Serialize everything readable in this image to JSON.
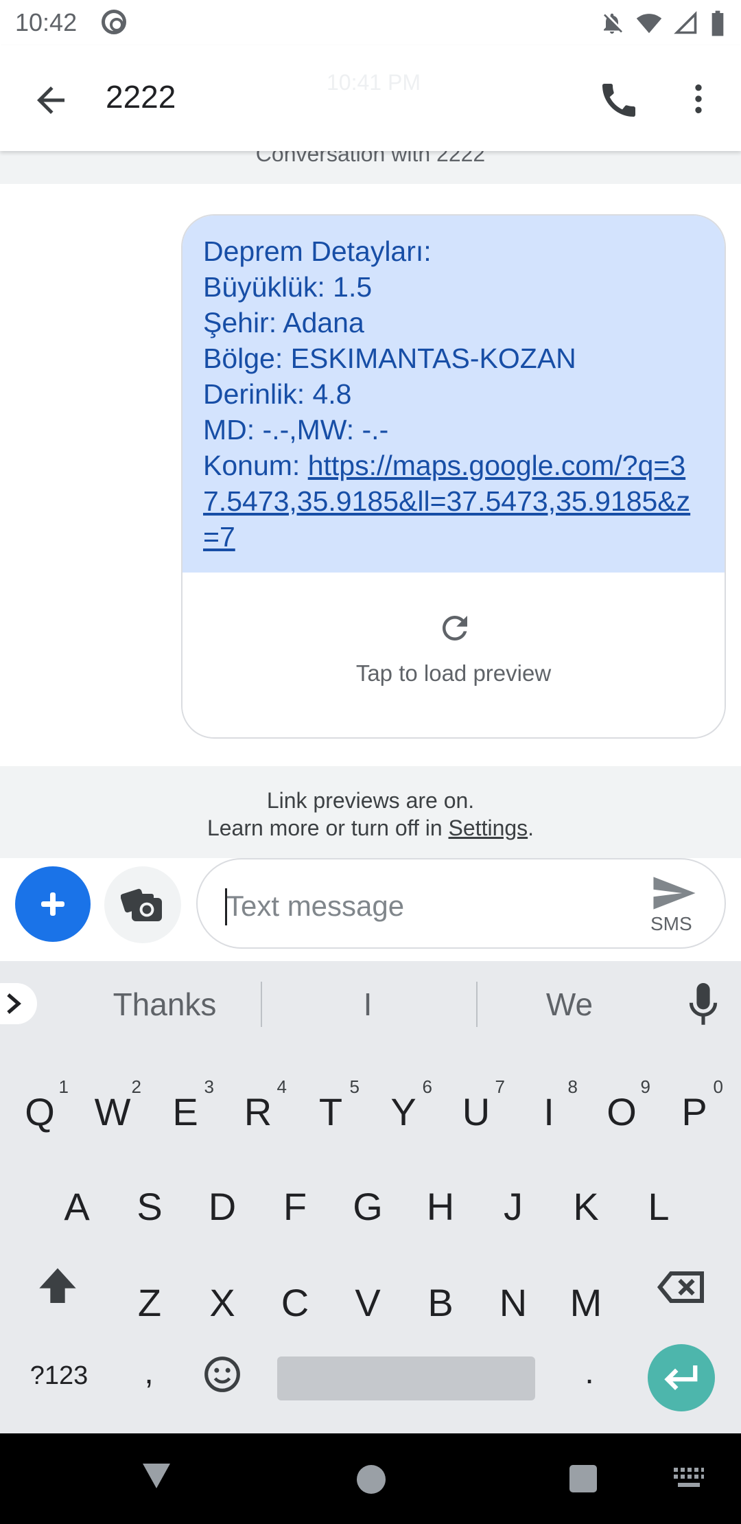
{
  "status_bar": {
    "time": "10:42"
  },
  "app_bar": {
    "title": "2222",
    "ghost_time": "10:41 PM"
  },
  "conversation_label": "Conversation with 2222",
  "message": {
    "lines": [
      "Deprem Detayları:",
      "Büyüklük: 1.5",
      "Şehir: Adana",
      "Bölge: ESKIMANTAS-KOZAN",
      "Derinlik: 4.8",
      "MD: -.-,MW: -.-"
    ],
    "location_label": "Konum: ",
    "location_link": "https://maps.google.com/?q=37.5473,35.9185&ll=37.5473,35.9185&z=7",
    "preview_label": "Tap to load preview"
  },
  "link_notice": {
    "line1": "Link previews are on.",
    "line2_prefix": "Learn more or turn off in ",
    "settings_link": "Settings",
    "line2_suffix": "."
  },
  "compose": {
    "placeholder": "Text message",
    "send_type": "SMS"
  },
  "suggestions": [
    "Thanks",
    "I",
    "We"
  ],
  "keyboard": {
    "row1": [
      {
        "key": "Q",
        "hint": "1"
      },
      {
        "key": "W",
        "hint": "2"
      },
      {
        "key": "E",
        "hint": "3"
      },
      {
        "key": "R",
        "hint": "4"
      },
      {
        "key": "T",
        "hint": "5"
      },
      {
        "key": "Y",
        "hint": "6"
      },
      {
        "key": "U",
        "hint": "7"
      },
      {
        "key": "I",
        "hint": "8"
      },
      {
        "key": "O",
        "hint": "9"
      },
      {
        "key": "P",
        "hint": "0"
      }
    ],
    "row2": [
      "A",
      "S",
      "D",
      "F",
      "G",
      "H",
      "J",
      "K",
      "L"
    ],
    "row3": [
      "Z",
      "X",
      "C",
      "V",
      "B",
      "N",
      "M"
    ],
    "symbols_label": "?123",
    "comma": ",",
    "period": "."
  },
  "colors": {
    "accent": "#1a73e8",
    "bubble_bg": "#d3e3fd",
    "bubble_text": "#174ea6",
    "enter_key": "#4db6ac"
  }
}
